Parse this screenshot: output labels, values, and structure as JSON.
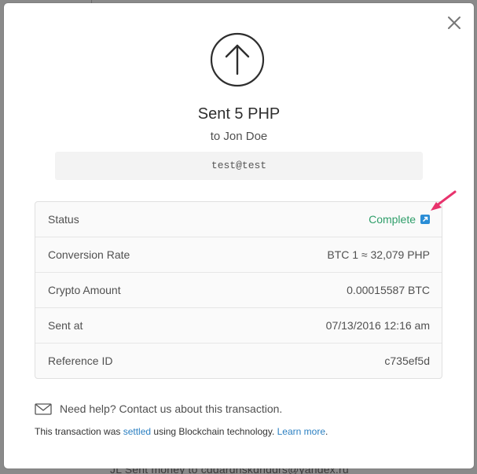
{
  "modal": {
    "title": "Sent 5 PHP",
    "subtitle": "to Jon Doe",
    "memo": "test@test",
    "details": [
      {
        "label": "Status",
        "value": "Complete"
      },
      {
        "label": "Conversion Rate",
        "value": "BTC 1 ≈ 32,079 PHP"
      },
      {
        "label": "Crypto Amount",
        "value": "0.00015587 BTC"
      },
      {
        "label": "Sent at",
        "value": "07/13/2016 12:16 am"
      },
      {
        "label": "Reference ID",
        "value": "c735ef5d"
      }
    ],
    "help_text": "Need help? Contact us about this transaction.",
    "footer": {
      "prefix": "This transaction was ",
      "settled_link": "settled",
      "middle": " using Blockchain technology. ",
      "learn_more_link": "Learn more",
      "suffix": "."
    }
  },
  "background": {
    "partial_text": "JL    Sent money to cddardnskdnddrs@yandex.ru"
  },
  "colors": {
    "status_complete": "#2f9e6a",
    "link": "#2a7fc1",
    "annotation_arrow": "#e8336d"
  },
  "icons": {
    "close": "close-icon",
    "sent": "arrow-up-circle-icon",
    "external_link": "external-link-icon",
    "mail": "mail-icon"
  }
}
